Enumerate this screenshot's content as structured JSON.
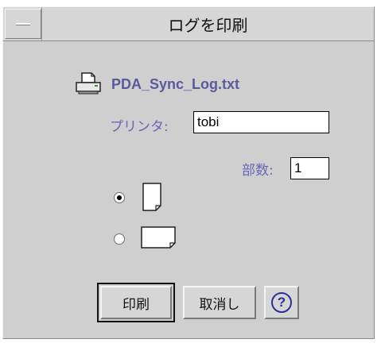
{
  "window": {
    "title": "ログを印刷"
  },
  "file": {
    "name": "PDA_Sync_Log.txt"
  },
  "printer": {
    "label": "プリンタ:",
    "value": "tobi"
  },
  "copies": {
    "label": "部数:",
    "value": "1"
  },
  "orientation": {
    "options": [
      {
        "name": "portrait",
        "selected": true
      },
      {
        "name": "landscape",
        "selected": false
      }
    ]
  },
  "buttons": {
    "print_label": "印刷",
    "cancel_label": "取消し",
    "help_label": "?"
  },
  "colors": {
    "background": "#cfcfcf",
    "label_text": "#6a66b6",
    "filename_text": "#5a5a9a",
    "help_accent": "#2e2e9a"
  }
}
